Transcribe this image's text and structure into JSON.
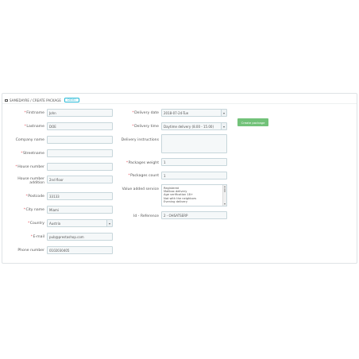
{
  "header": {
    "title": "SAMEDAYRE / CREATE PACKAGE",
    "badge": "DEMO"
  },
  "left_form": {
    "firstname": {
      "label": "Firstname",
      "required": true,
      "value": "John"
    },
    "lastname": {
      "label": "Lastname",
      "required": true,
      "value": "DOE"
    },
    "company": {
      "label": "Company name",
      "required": false,
      "value": ""
    },
    "streetname": {
      "label": "Streetname",
      "required": true,
      "value": ""
    },
    "house_number": {
      "label": "House number",
      "required": true,
      "value": ""
    },
    "house_addition": {
      "label_line1": "House number",
      "label_line2": "addition",
      "value": "2nd floor"
    },
    "postcode": {
      "label": "Postcode",
      "required": true,
      "value": "33133"
    },
    "city": {
      "label": "City name",
      "required": true,
      "value": "Miami"
    },
    "country": {
      "label": "Country",
      "required": true,
      "value": "Austria"
    },
    "email": {
      "label": "E-mail",
      "required": true,
      "value": "pub@prestashop.com"
    },
    "phone": {
      "label": "Phone number",
      "required": false,
      "value": "0102030405"
    }
  },
  "right_form": {
    "delivery_date": {
      "label": "Delivery date",
      "required": true,
      "value": "2018-07-24-Tue"
    },
    "delivery_time": {
      "label": "Delivery time",
      "required": true,
      "value": "Daytime delivery (8.00 - 15.00)"
    },
    "delivery_instructions": {
      "label": "Delivery instructions",
      "value": ""
    },
    "packages_weight": {
      "label": "Packages weight",
      "required": true,
      "value": "1"
    },
    "packages_count": {
      "label": "Packages count",
      "required": true,
      "value": "1"
    },
    "value_added_service": {
      "label": "Value added service",
      "options": [
        "Registered",
        "Mailbox delivery",
        "Age verification 18+",
        "Not with the neighbors",
        "Evening delivery"
      ]
    },
    "reference": {
      "label": "Id - Reference",
      "value": "2 - OHSATSERP"
    }
  },
  "actions": {
    "create_package": "Create package"
  },
  "colors": {
    "required_star": "#e5545d",
    "button": "#72c279",
    "badge": "#25b9d7"
  }
}
